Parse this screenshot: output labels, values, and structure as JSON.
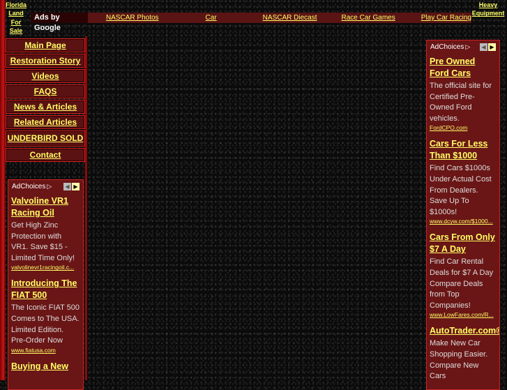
{
  "top_left_link": "Florida Land For Sale",
  "top_right_link": "Heavy Equipment",
  "topbar": {
    "ads_label": "Ads by Google",
    "links": [
      "NASCAR Photos",
      "Car",
      "NASCAR Diecast",
      "Race Car Games",
      "Play Car Racing"
    ]
  },
  "nav": {
    "items": [
      "Main Page",
      "Restoration Story",
      "Videos",
      "FAQS",
      "News & Articles",
      "Related Articles",
      "UNDERBIRD SOLD",
      "Contact"
    ]
  },
  "left_ads": {
    "adchoices": "AdChoices",
    "ads": [
      {
        "title": "Valvoline VR1 Racing Oil",
        "desc": "Get High Zinc Protection with VR1. Save $15 - Limited Time Only!",
        "url": "valvolinevr1racingoil.c..."
      },
      {
        "title": "Introducing The FIAT 500",
        "desc": "The Iconic FIAT 500 Comes to The USA. Limited Edition. Pre-Order Now",
        "url": "www.fiatusa.com"
      },
      {
        "title": "Buying a New",
        "desc": "",
        "url": ""
      }
    ]
  },
  "right_ads": {
    "adchoices": "AdChoices",
    "ads": [
      {
        "title": "Pre Owned Ford Cars",
        "desc": "The official site for Certified Pre-Owned Ford vehicles.",
        "url": "FordCPO.com"
      },
      {
        "title": "Cars For Less Than $1000",
        "desc": "Find Cars $1000s Under Actual Cost From Dealers. Save Up To $1000s!",
        "url": "www.dcyw.com/$1000..."
      },
      {
        "title": "Cars From Only $7 A Day",
        "desc": "Find Car Rental Deals for $7 A Day Compare Deals from Top Companies!",
        "url": "www.LowFares.com/R..."
      },
      {
        "title": "AutoTrader.com®",
        "desc": "Make New Car Shopping Easier. Compare New Cars",
        "url": ""
      }
    ]
  }
}
